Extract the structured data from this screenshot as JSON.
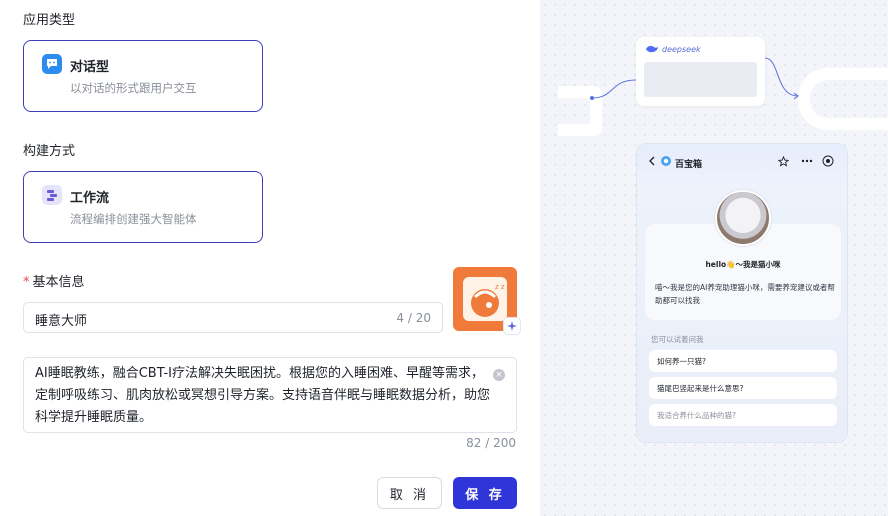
{
  "form": {
    "app_type_label": "应用类型",
    "app_type": {
      "title": "对话型",
      "desc": "以对话的形式跟用户交互"
    },
    "build_label": "构建方式",
    "build": {
      "title": "工作流",
      "desc": "流程编排创建强大智能体"
    },
    "basic_info_label": "基本信息",
    "required_mark": "*",
    "name_value": "睡意大师",
    "name_count": "4 / 20",
    "description": "AI睡眠教练，融合CBT-I疗法解决失眠困扰。根据您的入睡困难、早醒等需求，定制呼吸练习、肌肉放松或冥想引导方案。支持语音伴眠与睡眠数据分析，助您科学提升睡眠质量。",
    "desc_count": "82 / 200",
    "cancel_label": "取 消",
    "save_label": "保 存"
  },
  "preview": {
    "node_label": "deepseek",
    "chat_title": "百宝箱",
    "greeting": "hello👋～我是猫小咪",
    "intro": "喵～我是您的AI养宠助理猫小咪，需要养宠建议或者帮助都可以找我",
    "try_label": "您可以试着问我",
    "questions": [
      "如何养一只猫?",
      "猫尾巴竖起来是什么意思?",
      "我适合养什么品种的猫?"
    ]
  },
  "colors": {
    "accent": "#2f35d9",
    "card_border": "#3d3fb8",
    "required": "#e5484d",
    "app_icon": "#f07a3a"
  }
}
